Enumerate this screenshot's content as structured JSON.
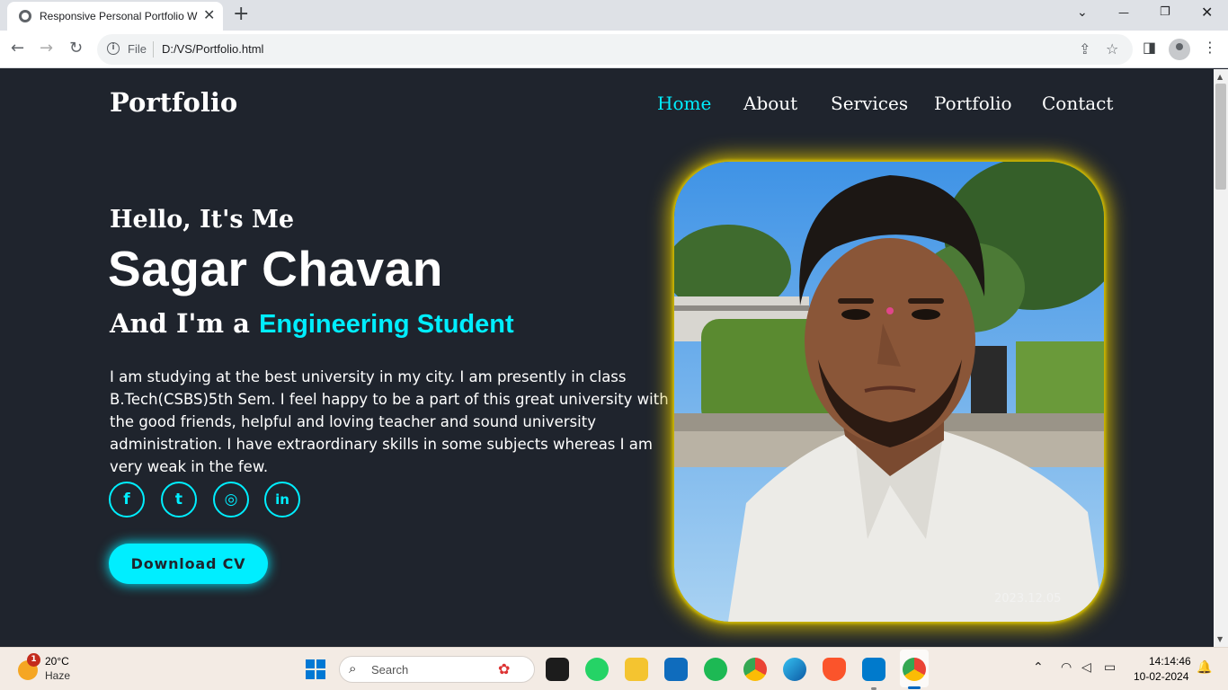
{
  "browser": {
    "tab_title": "Responsive Personal Portfolio W",
    "tab_close": "✕",
    "new_tab": "+",
    "win_minimize": "—",
    "win_restore": "❐",
    "win_close": "✕",
    "tab_search": "⌄",
    "back": "←",
    "forward": "→",
    "reload": "↻",
    "file_label": "File",
    "url": "D:/VS/Portfolio.html",
    "menu": "⋮"
  },
  "header": {
    "logo": "Portfolio",
    "nav": [
      "Home",
      "About",
      "Services",
      "Portfolio",
      "Contact"
    ],
    "active_nav": "Home"
  },
  "hero": {
    "greeting": "Hello, It's Me",
    "name": "Sagar Chavan",
    "role_prefix": "And I'm a ",
    "role_highlight": "Engineering Student",
    "bio": "I am studying at the best university in my city. I am presently in class B.Tech(CSBS)5th Sem. I feel happy to be a part of this great university with the good friends, helpful and loving teacher and sound university administration. I have extraordinary skills in some subjects whereas I am very weak in the few.",
    "social": [
      {
        "icon": "facebook-icon",
        "glyph": "f"
      },
      {
        "icon": "twitter-icon",
        "glyph": "t"
      },
      {
        "icon": "instagram-icon",
        "glyph": "◎"
      },
      {
        "icon": "linkedin-icon",
        "glyph": "in"
      }
    ],
    "cv_button": "Download CV",
    "photo_stamp": "2023.12.05"
  },
  "colors": {
    "accent": "#00eeff",
    "background": "#1f242d",
    "photo_glow": "#c8b000"
  },
  "taskbar": {
    "weather_temp": "20°C",
    "weather_desc": "Haze",
    "weather_badge": "1",
    "search_label": "Search",
    "search_glyph": "⌕",
    "apps": [
      "file-explorer-icon",
      "task-view-icon",
      "whatsapp-icon",
      "folder-icon",
      "app-store-icon",
      "spotify-icon",
      "chrome-icon",
      "edge-icon",
      "brave-icon",
      "vscode-icon",
      "chrome-active-icon"
    ],
    "time": "14:14:46",
    "date": "10-02-2024"
  }
}
